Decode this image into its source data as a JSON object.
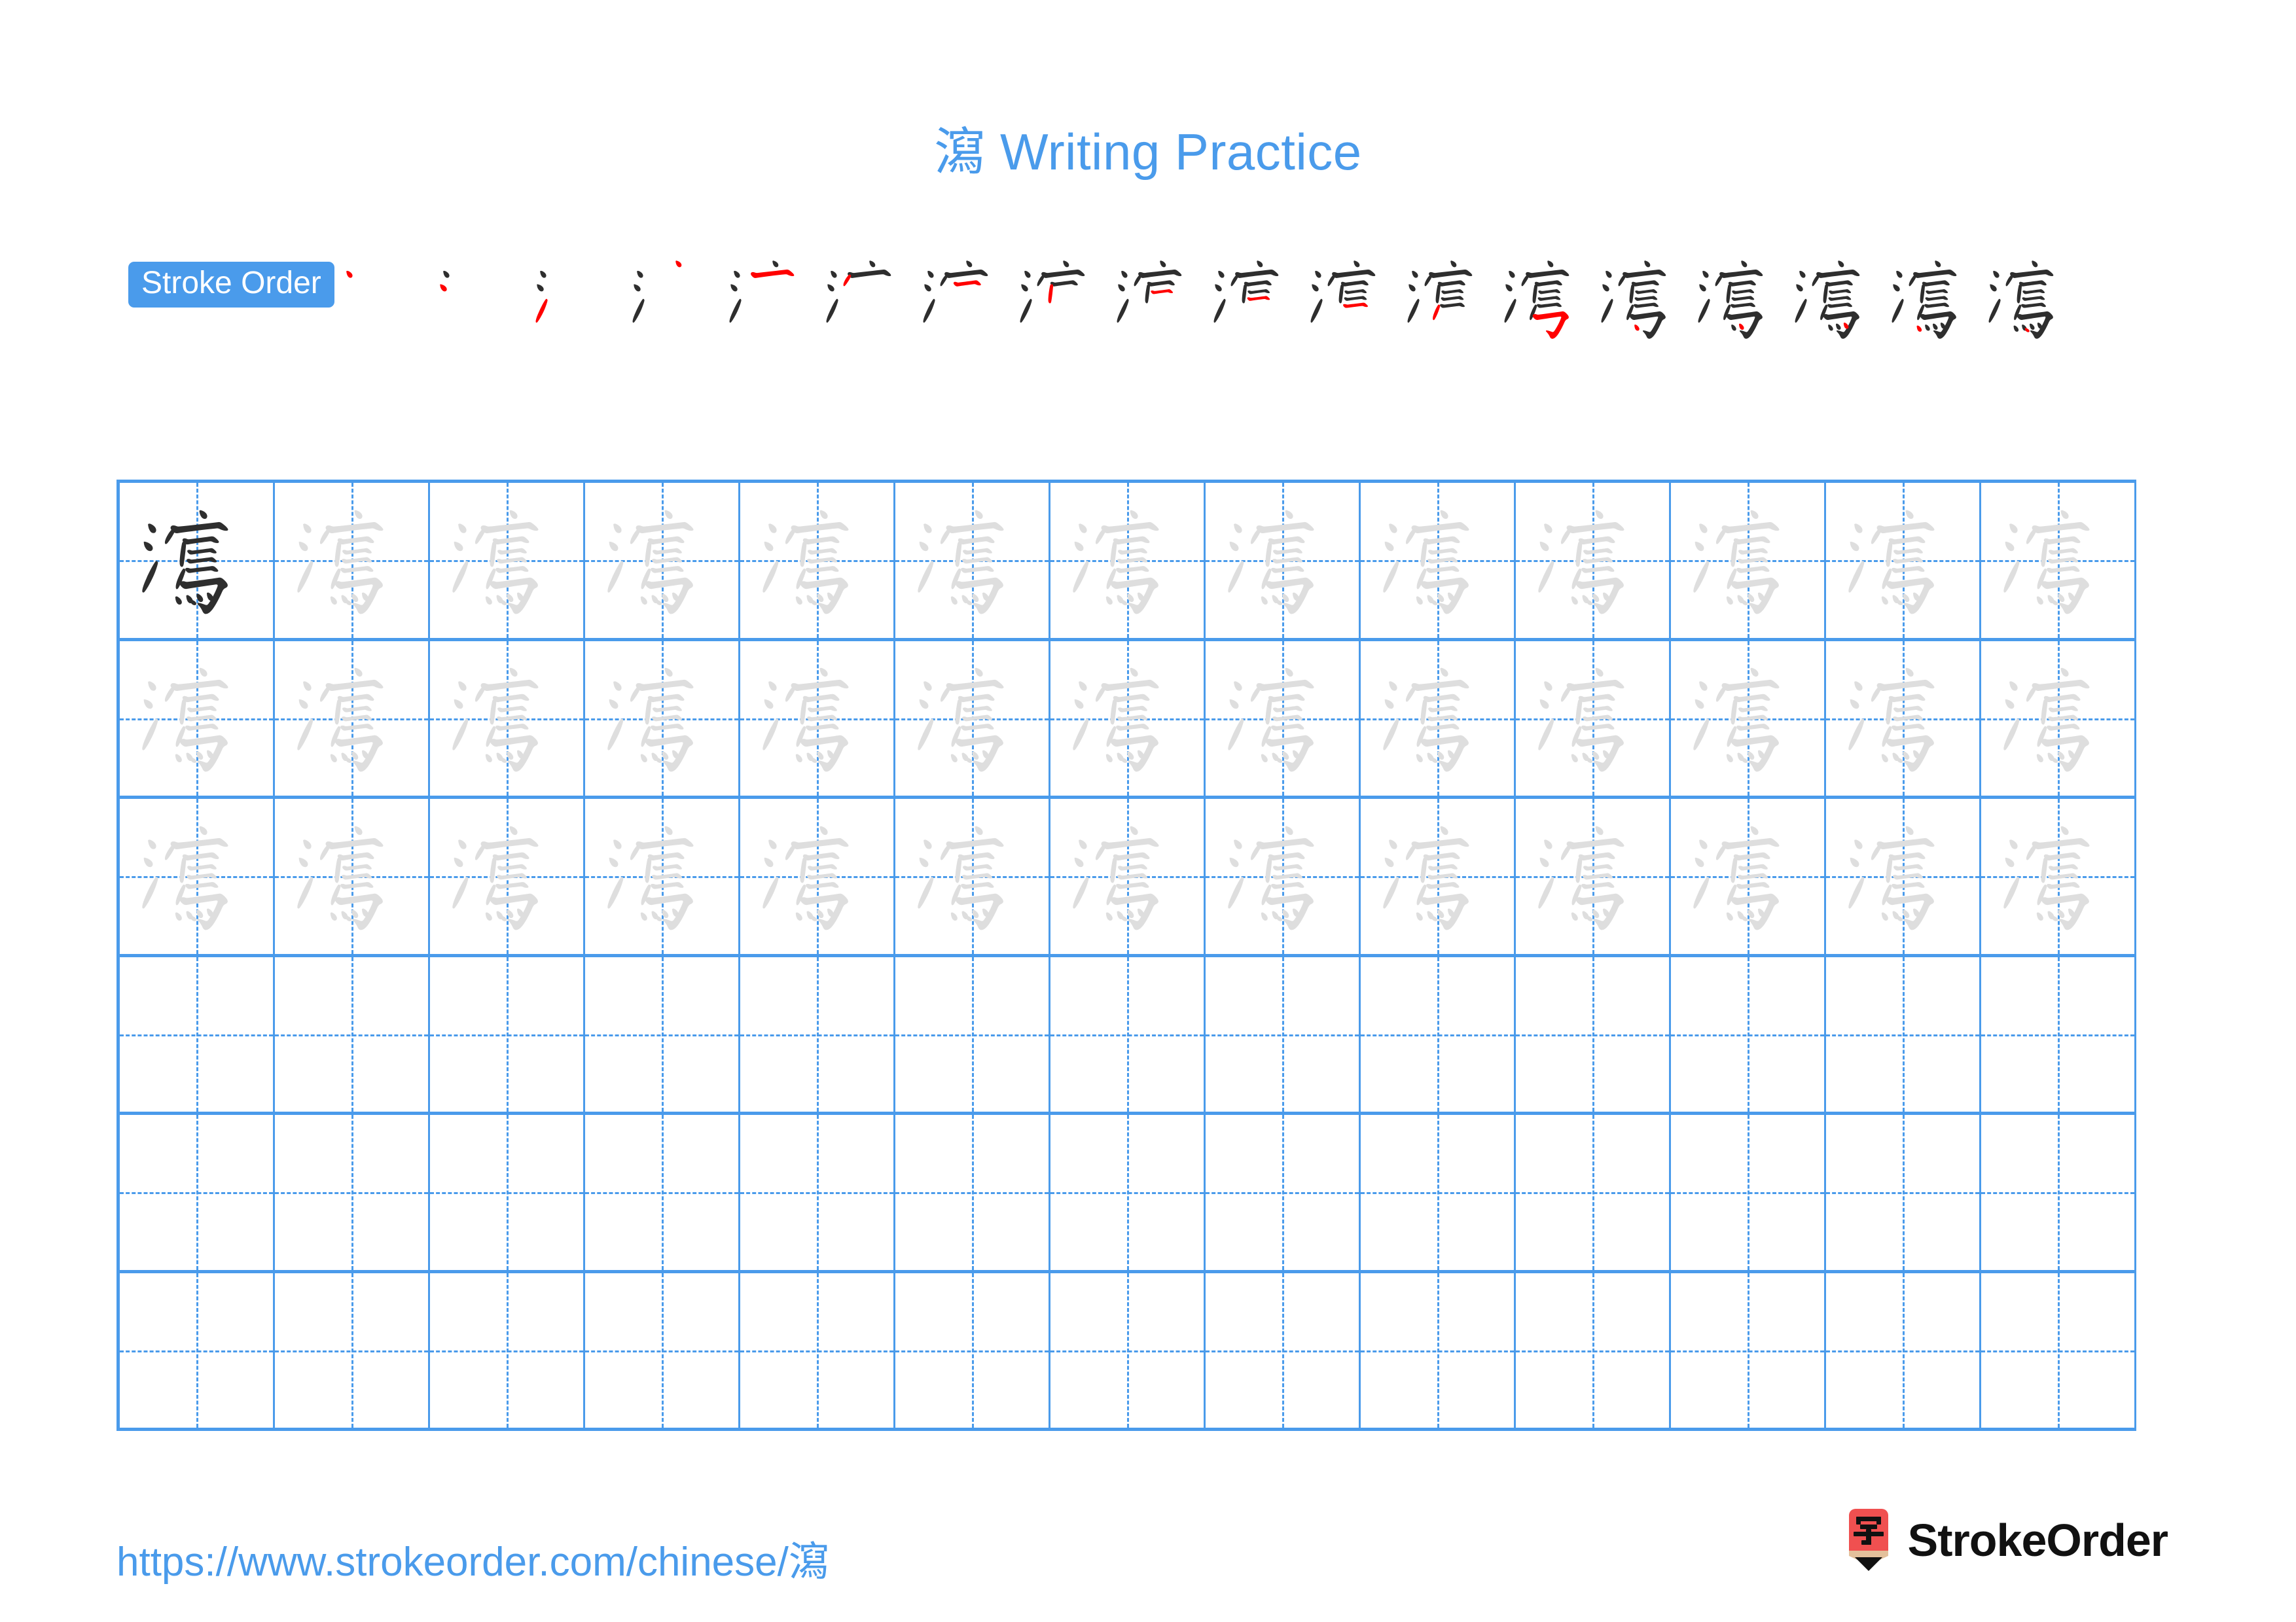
{
  "page": {
    "character": "瀉",
    "title_suffix": " Writing Practice",
    "background": "#ffffff"
  },
  "colors": {
    "accent_blue": "#4a9beb",
    "grid_blue": "#4a9beb",
    "stroke_dark": "#2e2e2e",
    "stroke_new_red": "#ff0000",
    "trace_gray": "#dedede",
    "logo_red": "#f05050",
    "logo_wood": "#e3c09b",
    "logo_tip": "#111111",
    "brand_text": "#111111"
  },
  "header": {
    "title_character": "瀉",
    "title_text": "Writing Practice"
  },
  "stroke_order": {
    "badge_label": "Stroke Order",
    "total_strokes": 18,
    "steps_first_line": 17,
    "steps_second_line": 1,
    "new_stroke_color": "#ff0000",
    "existing_stroke_color": "#2e2e2e",
    "step_numbers": [
      1,
      2,
      3,
      4,
      5,
      6,
      7,
      8,
      9,
      10,
      11,
      12,
      13,
      14,
      15,
      16,
      17,
      18
    ]
  },
  "practice_grid": {
    "columns": 13,
    "rows": 6,
    "filled_rows": 3,
    "empty_rows": 3,
    "first_cell_style": "dark",
    "trace_cell_style": "light",
    "cell_guides": "dashed-cross",
    "total_cells": 78
  },
  "footer": {
    "url_text": "https://www.strokeorder.com/chinese/",
    "url_character": "瀉",
    "brand_name": "StrokeOrder",
    "logo_glyph": "字"
  }
}
